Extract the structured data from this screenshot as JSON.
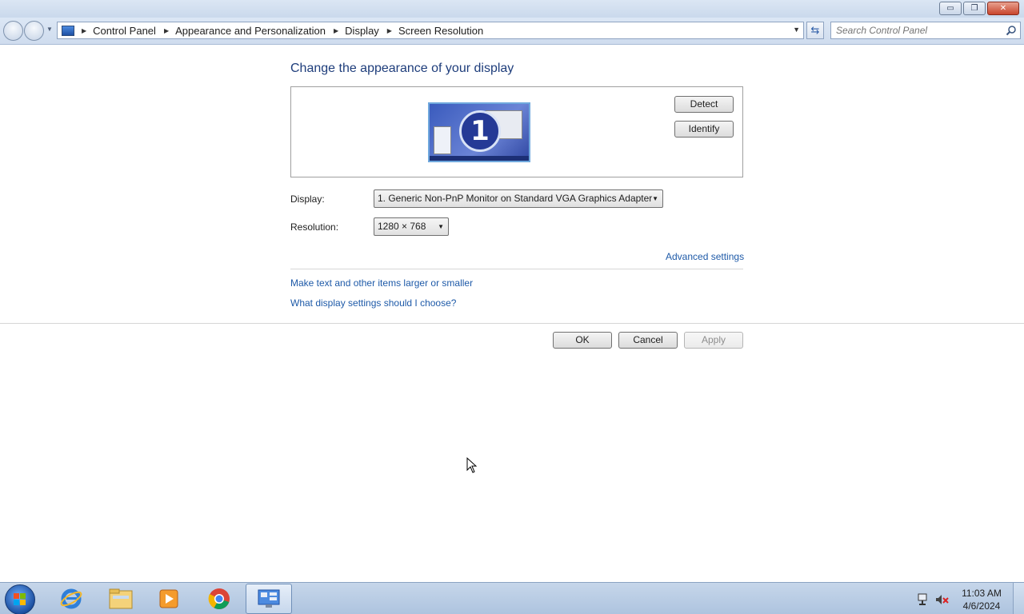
{
  "window": {
    "controls": {
      "minimize": "▭",
      "restore": "❐",
      "close": "✕"
    }
  },
  "address_bar": {
    "breadcrumbs": [
      "Control Panel",
      "Appearance and Personalization",
      "Display",
      "Screen Resolution"
    ]
  },
  "search": {
    "placeholder": "Search Control Panel"
  },
  "main": {
    "heading": "Change the appearance of your display",
    "monitor_number": "1",
    "detect_label": "Detect",
    "identify_label": "Identify",
    "display_label": "Display:",
    "display_value": "1. Generic Non-PnP Monitor on Standard VGA Graphics Adapter",
    "resolution_label": "Resolution:",
    "resolution_value": "1280 × 768",
    "advanced_link": "Advanced settings",
    "links": [
      "Make text and other items larger or smaller",
      "What display settings should I choose?"
    ]
  },
  "footer_buttons": {
    "ok": "OK",
    "cancel": "Cancel",
    "apply": "Apply"
  },
  "taskbar": {
    "apps": [
      "start-orb",
      "internet-explorer",
      "windows-explorer",
      "media-player",
      "chrome",
      "control-panel"
    ],
    "clock_time": "11:03 AM",
    "clock_date": "4/6/2024"
  },
  "colors": {
    "heading": "#1e3d7b",
    "link": "#1e5aa8",
    "monitor_bg": "#3a5bbd"
  }
}
